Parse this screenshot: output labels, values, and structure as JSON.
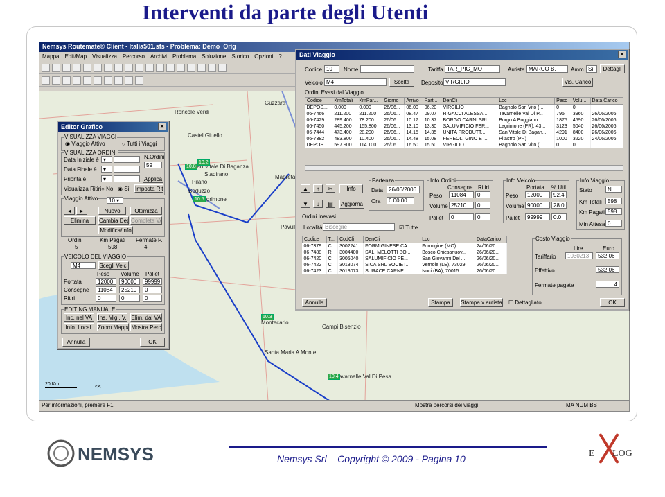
{
  "slide": {
    "title": "Interventi da parte degli Utenti",
    "footer": "Nemsys Srl – Copyright © 2009 - Pagina 10",
    "logo_left": "NEMSYS",
    "logo_right_a": "E",
    "logo_right_b": "LOG"
  },
  "app": {
    "title": "Nemsys Routemate® Client - Italia501.sfs - Problema: Demo_Orig",
    "menu": [
      "Mappa",
      "Edit/Map",
      "Visualizza",
      "Percorso",
      "Archivi",
      "Problema",
      "Soluzione",
      "Storico",
      "Opzioni",
      "?"
    ],
    "status_left": "Per informazioni, premere F1",
    "status_mid": "Mostra percorsi dei viaggi",
    "status_right": "MA NUM BS",
    "scale": "20 Km",
    "nav": "<<"
  },
  "map": {
    "towns": [
      "Roncole Verdi",
      "Castel Giuello",
      "San Vitale Di Baganza",
      "Stadirano",
      "Pilano",
      "Beduzzo",
      "Lagrimone",
      "Magreta",
      "Pavull",
      "Montecarlo",
      "Campi Bisenzio",
      "Santa Maria A Monte",
      "Tavarnelle Val Di Pesa",
      "Guzzara"
    ],
    "markers": [
      "10.8",
      "10.2",
      "10.5",
      "10.3",
      "10.4"
    ]
  },
  "editor": {
    "title": "Editor Grafico",
    "visualizza_viaggi": "VISUALIZZA VIAGGI",
    "viaggio_attivo": "Viaggio Attivo",
    "tutti_viaggi": "Tutti i Viaggi",
    "visualizza_ordini": "VISUALIZZA ORDINI",
    "data_iniziale": "Data Iniziale è",
    "data_finale": "Data Finale è",
    "priorita": "Priorità è",
    "n_ordini": "N.Ordini",
    "n_ordini_val": "59",
    "applica": "Applica",
    "vis_ritiri": "Visualizza Ritiri",
    "no": "No",
    "si": "Sì",
    "imposta_ritiri": "Imposta Ritiri",
    "viaggio_attivo_grp": "Viaggio Attivo",
    "viaggio_val": "10",
    "nuovo": "Nuovo",
    "ottimizza": "Ottimizza",
    "elimina": "Elimina",
    "cambia_dep": "Cambia Dep",
    "completa_va": "Completa VA",
    "modifica": "Modifica/Info",
    "h_ordini": "Ordini",
    "h_km": "Km Pagati",
    "h_fermate": "Fermate P.",
    "v_ordini": "5",
    "v_km": "598",
    "v_fermate": "4",
    "veicolo": "VEICOLO DEL VIAGGIO",
    "veicolo_val": "M4",
    "scegli": "Scegli Veic.",
    "h_peso": "Peso",
    "h_volume": "Volume",
    "h_pallet": "Pallet",
    "portata": "Portata",
    "consegne": "Consegne",
    "ritiri": "Ritiri",
    "portata_vals": [
      "12000",
      "90000",
      "99999"
    ],
    "consegne_vals": [
      "11084",
      "25210",
      "0"
    ],
    "ritiri_vals": [
      "0",
      "0",
      "0"
    ],
    "editing": "EDITING MANUALE",
    "ins_nel": "Inc. nel VA",
    "ins_migl": "Ins. Migl. V.",
    "elim": "Elim. dal VA",
    "info_local": "Info. Local.",
    "zoom": "Zoom Mappa",
    "mostra": "Mostra Perc",
    "annulla": "Annulla",
    "ok": "OK"
  },
  "dati": {
    "title": "Dati Viaggio",
    "codice": "Codice",
    "codice_val": "10",
    "nome": "Nome",
    "tariffa": "Tariffa",
    "tariffa_val": "TAR_PIG_MOT",
    "autista": "Autista",
    "autista_val": "MARCO B.",
    "amm": "Amm.",
    "amm_val": "Sì",
    "dettagli": "Dettagli",
    "veicolo": "Veicolo",
    "veicolo_val": "M4",
    "scelta": "Scelta",
    "deposito": "Deposito",
    "deposito_val": "VIRGILIO",
    "vis_carico": "Vis. Carico",
    "ordini_evasi": "Ordini Evasi dal Viaggio",
    "cols1": [
      "Codice",
      "KmTotali",
      "KmPar...",
      "Giorno",
      "Arrivo",
      "Part...",
      "DenCli",
      "Loc",
      "Peso",
      "Volu...",
      "Data Carico"
    ],
    "rows1": [
      [
        "DEPOS...",
        "0.000",
        "0.000",
        "26/06...",
        "06.00",
        "06.20",
        "VIRGILIO",
        "Bagnolo San Vito (...",
        "0",
        "0",
        ""
      ],
      [
        "06-7466",
        "211.200",
        "211.200",
        "26/06...",
        "08.47",
        "09.07",
        "RIGACCI ALESSA...",
        "Tavarnelle Val Di P...",
        "795",
        "3960",
        "26/06/2006"
      ],
      [
        "06-7429",
        "289.400",
        "78.200",
        "26/06...",
        "10.17",
        "10.37",
        "BORGO CARNI SRL",
        "Borgo A Buggiano ...",
        "1875",
        "4590",
        "26/06/2006"
      ],
      [
        "06-7450",
        "445.200",
        "155.800",
        "26/06...",
        "13.10",
        "13.30",
        "SALUMIFICIO FER...",
        "Lagrimone (PR), 43...",
        "3123",
        "5040",
        "26/06/2006"
      ],
      [
        "06-7444",
        "473.400",
        "28.200",
        "26/06...",
        "14.15",
        "14.35",
        "UNITA PRODUTT...",
        "San Vitale Di Bagan...",
        "4291",
        "8400",
        "26/06/2006"
      ],
      [
        "06-7382",
        "483.800",
        "10.400",
        "26/06...",
        "14.48",
        "15.08",
        "FEREOLI GINO E ...",
        "Pilastro (PR)",
        "1000",
        "3220",
        "24/06/2006"
      ],
      [
        "DEPOS...",
        "597.900",
        "114.100",
        "26/06...",
        "16.50",
        "15.50",
        "VIRGILIO",
        "Bagnolo San Vito (...",
        "0",
        "0",
        ""
      ]
    ],
    "partenza": "Partenza",
    "data": "Data",
    "data_val": "26/06/2006",
    "ora": "Ora",
    "ora_val": "6.00.00",
    "info_btn": "Info",
    "aggiorna": "Aggiorna",
    "info_ordini": "Info Ordini",
    "consegne": "Consegne",
    "ritiri": "Ritiri",
    "peso": "Peso",
    "volume": "Volume",
    "pallet": "Pallet",
    "io_peso": [
      "11084",
      "0"
    ],
    "io_volume": [
      "25210",
      "0"
    ],
    "io_pallet": [
      "0",
      "0"
    ],
    "info_veicolo": "Info Veicolo",
    "portata": "Portata",
    "util": "% Util.",
    "iv_peso": [
      "12000",
      "92.4"
    ],
    "iv_volume": [
      "90000",
      "28.0"
    ],
    "iv_pallet": [
      "99999",
      "0.0"
    ],
    "info_viaggio": "Info Viaggio",
    "stato": "Stato",
    "stato_val": "N",
    "km_totali": "Km Totali",
    "km_totali_val": "598",
    "km_pagati": "Km Pagati",
    "km_pagati_val": "598",
    "min_attesa": "Min Attesa",
    "min_attesa_val": "0",
    "ordini_inevasi": "Ordini Inevasi",
    "localita": "Località",
    "localita_val": "Bisceglie",
    "tutte": "Tutte",
    "cols2": [
      "Codice",
      "T...",
      "CodCli",
      "DenCli",
      "Loc",
      "DataCarico"
    ],
    "rows2": [
      [
        "06-7379",
        "C",
        "3002241",
        "FORMIGINESE CA...",
        "Formigine (MO)",
        "24/06/20..."
      ],
      [
        "06-7488",
        "R",
        "3004400",
        "SAL. MELOTTI BO...",
        "Bosco Chiesanuov...",
        "26/06/20..."
      ],
      [
        "06-7420",
        "C",
        "3005040",
        "SALUMIFICIO PE...",
        "San Giovanni Del ...",
        "26/06/20..."
      ],
      [
        "06-7422",
        "C",
        "3013074",
        "SICA SRL SOCIET...",
        "Vernole (LE), 73029",
        "26/06/20..."
      ],
      [
        "06-7423",
        "C",
        "3013073",
        "SURACE CARNE ...",
        "Noci (BA), 70015",
        "26/06/20..."
      ]
    ],
    "costo": "Costo Viaggio",
    "lire": "Lire",
    "euro": "Euro",
    "tariffario": "Tariffario",
    "tariffario_lire": "1030213",
    "tariffario_euro": "532.06",
    "effettivo": "Effettivo",
    "effettivo_euro": "532.06",
    "fermate": "Fermate pagate",
    "fermate_val": "4",
    "annulla": "Annulla",
    "stampa": "Stampa",
    "stampa_autista": "Stampa x autista",
    "dettagliato": "Dettagliato",
    "ok": "OK"
  }
}
